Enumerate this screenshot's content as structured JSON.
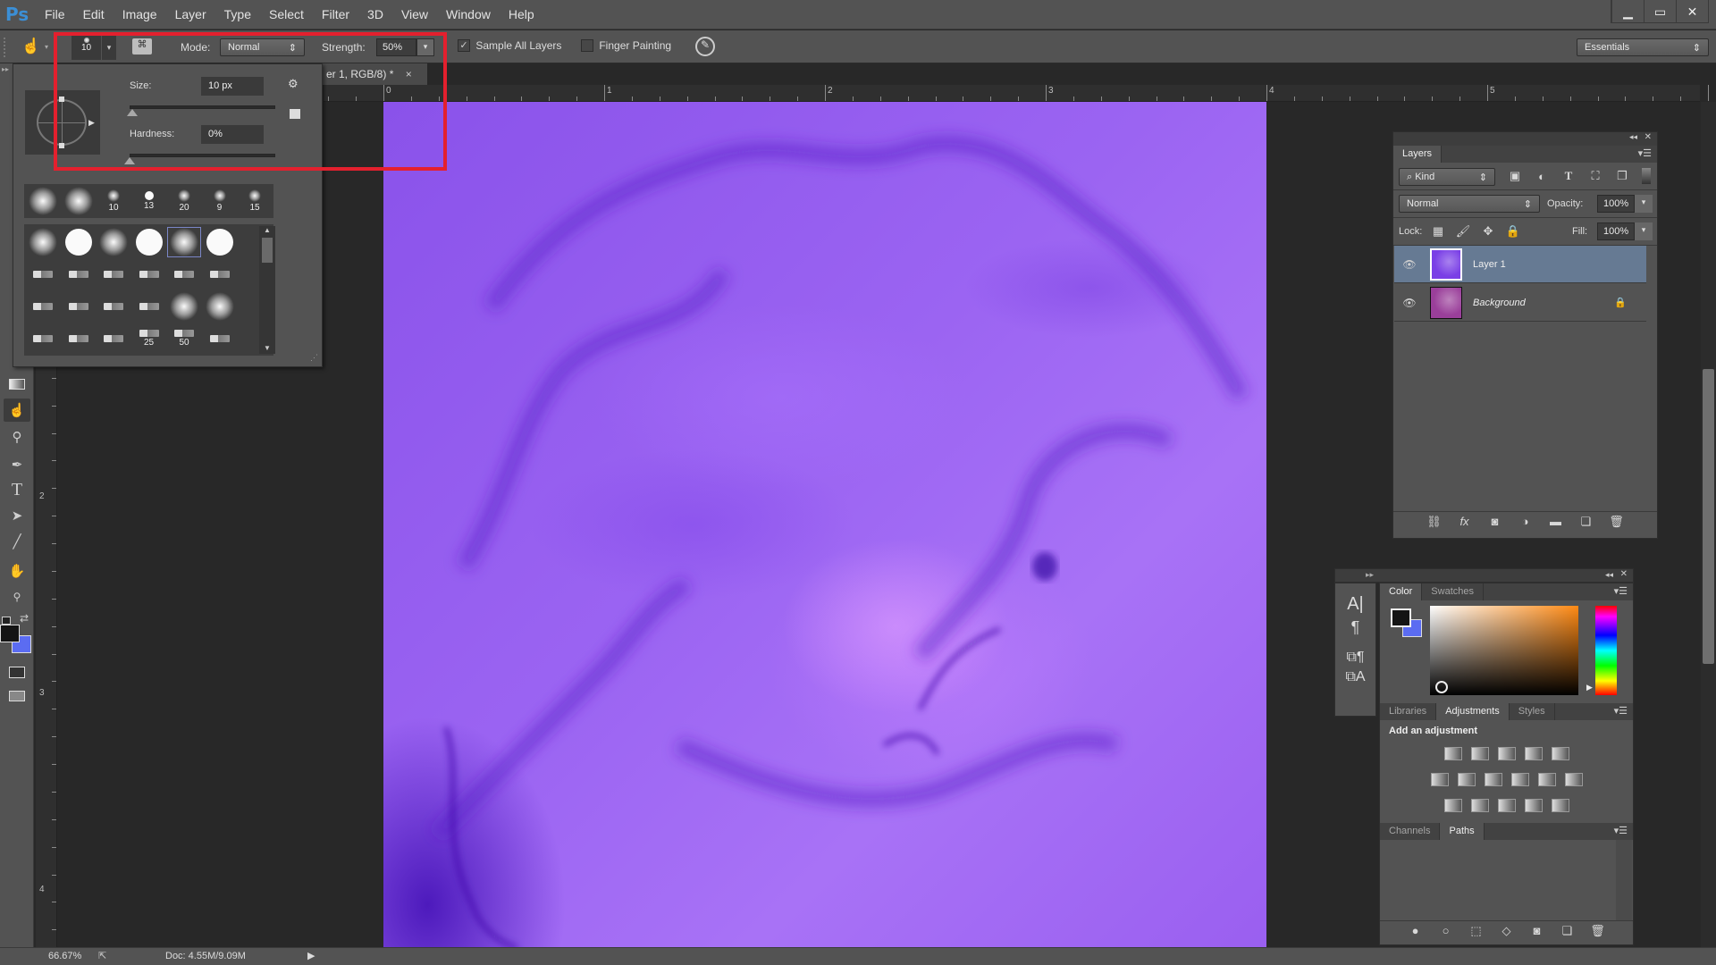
{
  "app": {
    "logo": "Ps",
    "menu": [
      "File",
      "Edit",
      "Image",
      "Layer",
      "Type",
      "Select",
      "Filter",
      "3D",
      "View",
      "Window",
      "Help"
    ],
    "window_controls": {
      "minimize": "minimize-icon",
      "maximize": "maximize-icon",
      "close": "close-icon"
    }
  },
  "options_bar": {
    "tool_icon": "smudge-icon",
    "brush_size": "10",
    "mode_label": "Mode:",
    "mode_value": "Normal",
    "strength_label": "Strength:",
    "strength_value": "50%",
    "sample_all_layers_label": "Sample All Layers",
    "sample_all_layers_checked": true,
    "finger_painting_label": "Finger Painting",
    "finger_painting_checked": false,
    "workspace": "Essentials"
  },
  "brush_picker": {
    "size_label": "Size:",
    "size_value": "10 px",
    "size_fraction": 0.02,
    "hardness_label": "Hardness:",
    "hardness_value": "0%",
    "hardness_fraction": 0.0,
    "recent_presets": [
      {
        "type": "soft",
        "label": ""
      },
      {
        "type": "soft",
        "label": ""
      },
      {
        "type": "soft",
        "label": "10"
      },
      {
        "type": "hard",
        "label": "13"
      },
      {
        "type": "soft",
        "label": "20"
      },
      {
        "type": "soft",
        "label": "9"
      },
      {
        "type": "soft",
        "label": "15"
      }
    ],
    "presets": [
      {
        "type": "soft",
        "label": ""
      },
      {
        "type": "hard",
        "label": ""
      },
      {
        "type": "soft",
        "label": ""
      },
      {
        "type": "hard",
        "label": ""
      },
      {
        "type": "soft",
        "label": "",
        "selected": true
      },
      {
        "type": "hard",
        "label": ""
      },
      {
        "type": "tip",
        "label": ""
      },
      {
        "type": "tip",
        "label": ""
      },
      {
        "type": "tip",
        "label": ""
      },
      {
        "type": "tip",
        "label": ""
      },
      {
        "type": "tip",
        "label": ""
      },
      {
        "type": "tip",
        "label": ""
      },
      {
        "type": "tip",
        "label": ""
      },
      {
        "type": "tip",
        "label": ""
      },
      {
        "type": "tip",
        "label": ""
      },
      {
        "type": "tip",
        "label": ""
      },
      {
        "type": "soft",
        "label": ""
      },
      {
        "type": "soft",
        "label": ""
      },
      {
        "type": "tip",
        "label": ""
      },
      {
        "type": "tip",
        "label": ""
      },
      {
        "type": "tip",
        "label": ""
      },
      {
        "type": "tip",
        "label": "25"
      },
      {
        "type": "tip",
        "label": "50"
      },
      {
        "type": "tip",
        "label": ""
      }
    ]
  },
  "document": {
    "tab_title": "er 1, RGB/8) *",
    "tab_close": "×",
    "ruler_h_labels": [
      "0",
      "1",
      "2",
      "3",
      "4",
      "5"
    ],
    "ruler_v_labels": [
      "2",
      "3",
      "4"
    ]
  },
  "status": {
    "zoom": "66.67%",
    "doc_info": "Doc: 4.55M/9.09M"
  },
  "tools": [
    "move-icon",
    "marquee-icon",
    "lasso-icon",
    "quick-select-icon",
    "crop-icon",
    "eyedropper-icon",
    "healing-icon",
    "brush-icon",
    "stamp-icon",
    "history-brush-icon",
    "eraser-icon",
    "gradient-icon",
    "smudge-icon",
    "dodge-icon",
    "pen-icon",
    "type-icon",
    "path-select-icon",
    "line-icon",
    "hand-icon",
    "zoom-icon"
  ],
  "tool_glyphs": {
    "gradient": "▭",
    "smudge": "☝",
    "dodge": "⚲",
    "pen": "✒",
    "type": "T",
    "path": "➤",
    "line": "╱",
    "hand": "✋",
    "zoom": "🔍"
  },
  "colors": {
    "foreground": "#141414",
    "background": "#5b6cf2",
    "accent_selection": "#667a93",
    "red_annotation": "#e4202e"
  },
  "layers_panel": {
    "title": "Layers",
    "filter_kind": "Kind",
    "blend_mode": "Normal",
    "opacity_label": "Opacity:",
    "opacity_value": "100%",
    "lock_label": "Lock:",
    "fill_label": "Fill:",
    "fill_value": "100%",
    "layers": [
      {
        "name": "Layer 1",
        "visible": true,
        "selected": true,
        "locked": false,
        "thumb": "#7a3fe6"
      },
      {
        "name": "Background",
        "visible": true,
        "selected": false,
        "locked": true,
        "thumb": "#9a3f9a"
      }
    ]
  },
  "color_panel": {
    "tabs": [
      "Color",
      "Swatches"
    ],
    "active_tab": "Color"
  },
  "adjustments_panel": {
    "tabs": [
      "Libraries",
      "Adjustments",
      "Styles"
    ],
    "active_tab": "Adjustments",
    "heading": "Add an adjustment",
    "icons": [
      [
        "brightness-contrast-icon",
        "levels-icon",
        "curves-icon",
        "exposure-icon",
        "vibrance-icon"
      ],
      [
        "hue-saturation-icon",
        "color-balance-icon",
        "black-white-icon",
        "photo-filter-icon",
        "channel-mixer-icon",
        "color-lookup-icon"
      ],
      [
        "invert-icon",
        "posterize-icon",
        "threshold-icon",
        "selective-color-icon",
        "gradient-map-icon"
      ]
    ]
  },
  "paths_panel": {
    "tabs": [
      "Channels",
      "Paths"
    ],
    "active_tab": "Paths"
  }
}
